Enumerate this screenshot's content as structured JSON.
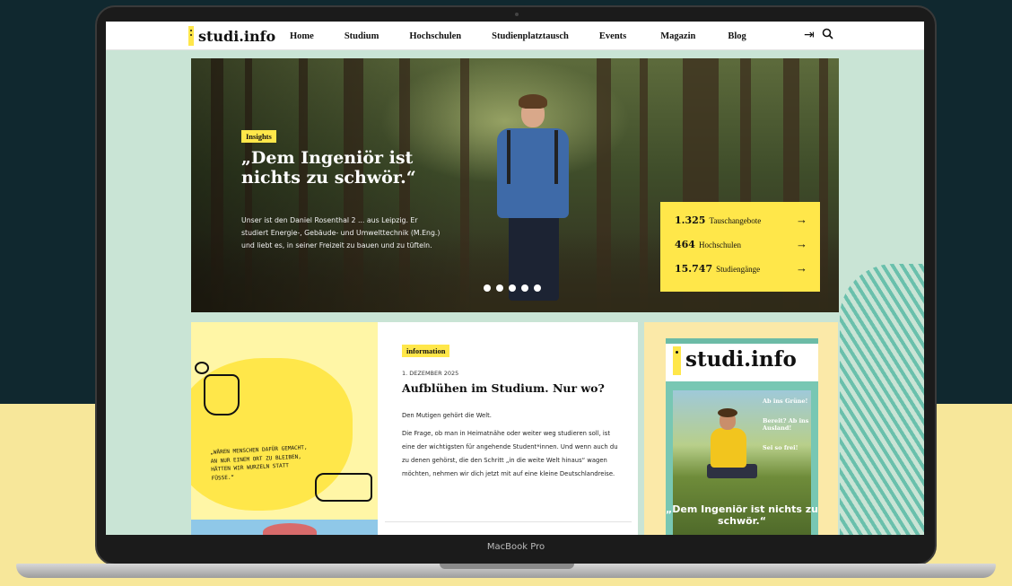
{
  "device": {
    "label": "MacBook Pro"
  },
  "site": {
    "logo": "studi.info",
    "nav": [
      "Home",
      "Studium",
      "Hochschulen",
      "Studienplatztausch",
      "Events",
      "Magazin",
      "Blog"
    ],
    "icons": [
      "login-arrow-icon",
      "search-icon"
    ]
  },
  "hero": {
    "tag": "Insights",
    "title": "„Dem Ingeniör ist nichts zu schwör.“",
    "text": "Unser ist den Daniel Rosenthal 2 ... aus Leipzig. Er studiert Energie-, Gebäude- und Umwelttechnik (M.Eng.) und liebt es, in seiner Freizeit zu bauen und zu tüfteln.",
    "slides": 5,
    "stats": [
      {
        "number": "1.325",
        "label": "Tauschangebote"
      },
      {
        "number": "464",
        "label": "Hochschulen"
      },
      {
        "number": "15.747",
        "label": "Studiengänge"
      }
    ]
  },
  "illustration": {
    "quote": "„WÄREN MENSCHEN DAFÜR GEMACHT, AN NUR EINEM ORT ZU BLEIBEN, HÄTTEN WIR WURZELN STATT FÜSSE.“"
  },
  "article": {
    "tag": "information",
    "date": "1. DEZEMBER 2025",
    "title": "Aufblühen im Studium. Nur wo?",
    "lead": "Den Mutigen gehört die Welt.",
    "body": "Die Frage, ob man in Heimatnähe oder weiter weg studieren soll, ist eine der wichtigsten für angehende Student*innen. Und wenn auch du zu denen gehörst, die den Schritt „in die weite Welt hinaus“ wagen möchten, nehmen wir dich jetzt mit auf eine kleine Deutschlandreise."
  },
  "magazine": {
    "logo": "studi.info",
    "side_titles": [
      "Ab ins Grüne!",
      "Bereit? Ab ins Ausland!",
      "Sei so frei!"
    ],
    "headline": "„Dem Ingeniör ist nichts zu schwör.“"
  },
  "colors": {
    "brand_yellow": "#ffe74a",
    "mint": "#c9e4d5",
    "teal": "#78c7b3",
    "dark_bg": "#10282f"
  }
}
